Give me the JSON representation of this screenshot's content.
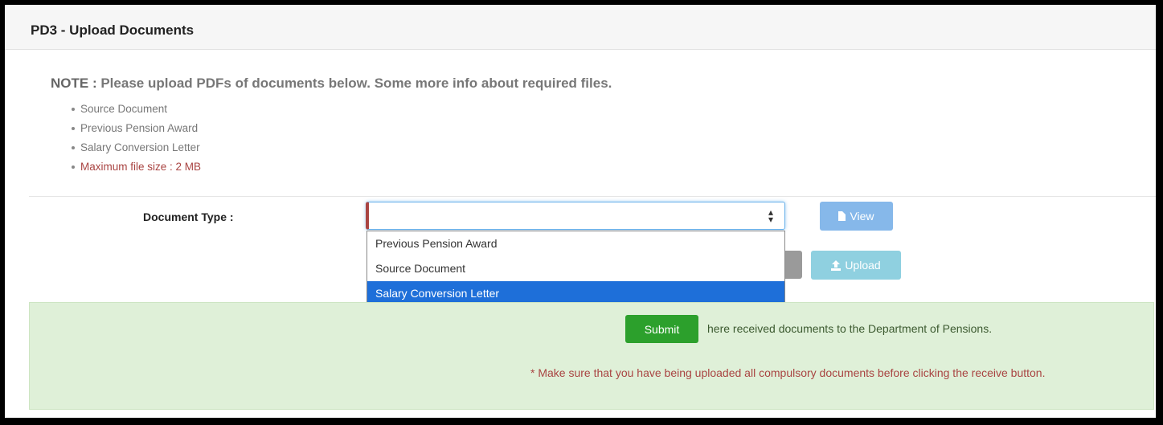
{
  "panel": {
    "title": "PD3 - Upload Documents"
  },
  "note": {
    "label": "NOTE :",
    "text": "Please upload PDFs of documents below. Some more info about required files.",
    "items": [
      "Source Document",
      "Previous Pension Award",
      "Salary Conversion Letter"
    ],
    "max_size": "Maximum file size : 2 MB"
  },
  "form": {
    "document_type_label": "Document Type :",
    "select_value": "",
    "options": [
      "Previous Pension Award",
      "Source Document",
      "Salary Conversion Letter"
    ],
    "highlighted_option": "Salary Conversion Letter",
    "view_label": "View",
    "upload_label": "Upload"
  },
  "submit": {
    "button_label": "Submit",
    "text": "here received documents to the Department of Pensions.",
    "warning": "* Make sure that you have being uploaded all compulsory documents before clicking the receive button."
  },
  "colors": {
    "select_option_highlight": "#1e6fd9",
    "submit_button": "#2ca02c",
    "warning": "#a94442",
    "success_background": "#dff0d8"
  }
}
